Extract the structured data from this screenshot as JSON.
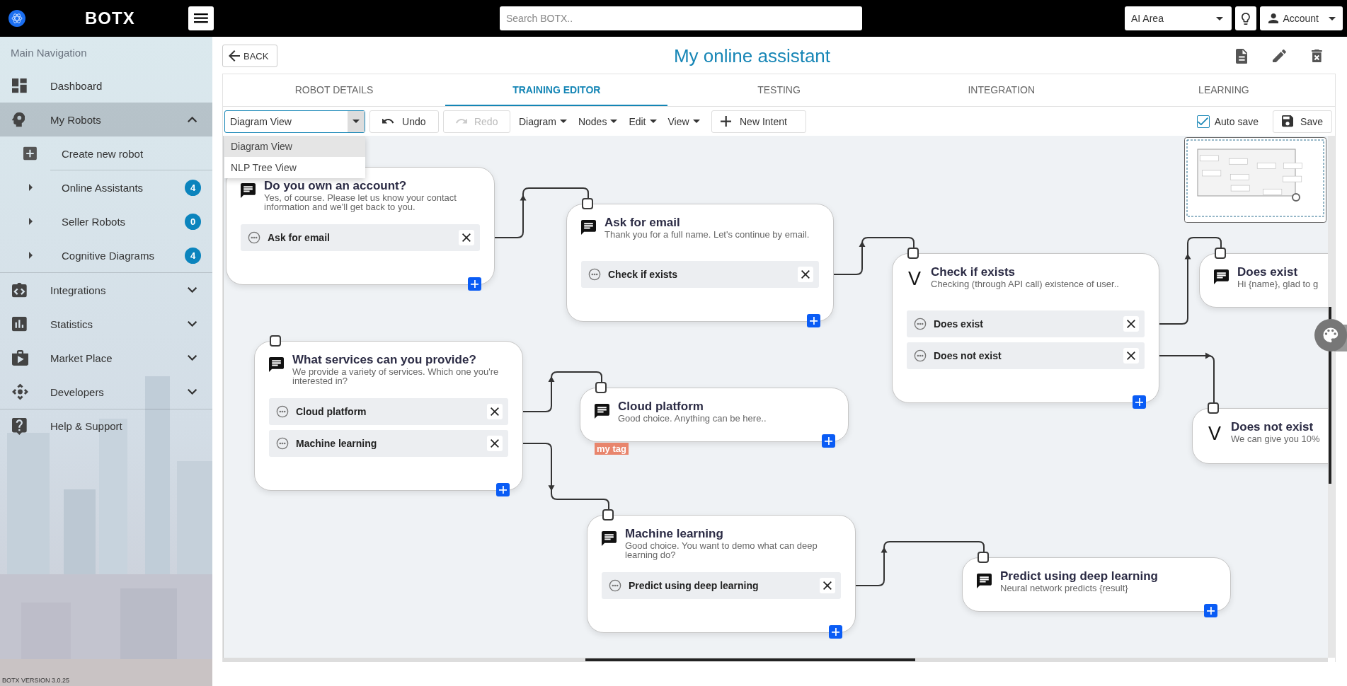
{
  "topbar": {
    "brand": "BOTX",
    "search": {
      "placeholder": "Search BOTX.."
    },
    "area_select": {
      "value": "AI Area"
    },
    "account": {
      "label": "Account"
    }
  },
  "sidebar": {
    "heading": "Main Navigation",
    "items": [
      {
        "label": "Dashboard",
        "selected": false
      },
      {
        "label": "My Robots",
        "selected": true,
        "expanded": true,
        "children": [
          {
            "kind": "action",
            "label": "Create new robot",
            "selected": false
          },
          {
            "kind": "folder",
            "label": "Online Assistants",
            "badge": "4",
            "expanded": false,
            "selected": false
          },
          {
            "kind": "folder",
            "label": "Seller Robots",
            "badge": "0",
            "expanded": false,
            "selected": false
          },
          {
            "kind": "folder",
            "label": "Cognitive Diagrams",
            "badge": "4",
            "expanded": false,
            "selected": false
          }
        ]
      },
      {
        "label": "Integrations",
        "selected": false,
        "expanded": false
      },
      {
        "label": "Statistics",
        "selected": false,
        "expanded": false
      },
      {
        "label": "Market Place",
        "selected": false,
        "expanded": false
      },
      {
        "label": "Developers",
        "selected": false,
        "expanded": false
      },
      {
        "label": "Help & Support",
        "selected": false
      }
    ],
    "version": "BOTX VERSION 3.0.25"
  },
  "page": {
    "back": "BACK",
    "title": "My online assistant"
  },
  "tabs": [
    {
      "label": "ROBOT DETAILS",
      "selected": false
    },
    {
      "label": "TRAINING EDITOR",
      "selected": true
    },
    {
      "label": "TESTING",
      "selected": false
    },
    {
      "label": "INTEGRATION",
      "selected": false
    },
    {
      "label": "LEARNING",
      "selected": false
    }
  ],
  "toolbar": {
    "view_select": {
      "value": "Diagram View",
      "expanded": true,
      "options": [
        {
          "label": "Diagram View",
          "selected": true
        },
        {
          "label": "NLP Tree View",
          "selected": false
        }
      ]
    },
    "undo": {
      "label": "Undo",
      "disabled": false
    },
    "redo": {
      "label": "Redo",
      "disabled": true
    },
    "menus": [
      "Diagram",
      "Nodes",
      "Edit",
      "View"
    ],
    "new_intent": "New Intent",
    "auto_save": {
      "label": "Auto save",
      "checked": true
    },
    "save": "Save"
  },
  "diagram": {
    "nodes": [
      {
        "kind": "message",
        "title": "Do you own an account?",
        "description": "Yes, of course. Please let us know your contact information and we'll get back to you.",
        "intents": [
          "Ask for email"
        ]
      },
      {
        "kind": "message",
        "title": "Ask for email",
        "description": "Thank you for a full name. Let's continue by email.",
        "intents": [
          "Check if exists"
        ]
      },
      {
        "kind": "validation",
        "symbol": "V",
        "title": "Check if exists",
        "description": "Checking (through API call) existence of user..",
        "intents": [
          "Does exist",
          "Does not exist"
        ]
      },
      {
        "kind": "message",
        "title": "Does exist",
        "description": "Hi {name}, glad to g"
      },
      {
        "kind": "validation",
        "symbol": "V",
        "title": "Does not exist",
        "description": "We can give you 10%"
      },
      {
        "kind": "message",
        "title": "What services can you provide?",
        "description": "We provide a variety of services. Which one you're interested in?",
        "intents": [
          "Cloud platform",
          "Machine learning"
        ]
      },
      {
        "kind": "message",
        "title": "Cloud platform",
        "description": "Good choice. Anything can be here..",
        "tags": [
          "my tag"
        ]
      },
      {
        "kind": "message",
        "title": "Machine learning",
        "description": "Good choice. You want to demo what can deep learning do?",
        "intents": [
          "Predict using deep learning"
        ]
      },
      {
        "kind": "message",
        "title": "Predict using deep learning",
        "description": "Neural network predicts {result}"
      }
    ]
  }
}
